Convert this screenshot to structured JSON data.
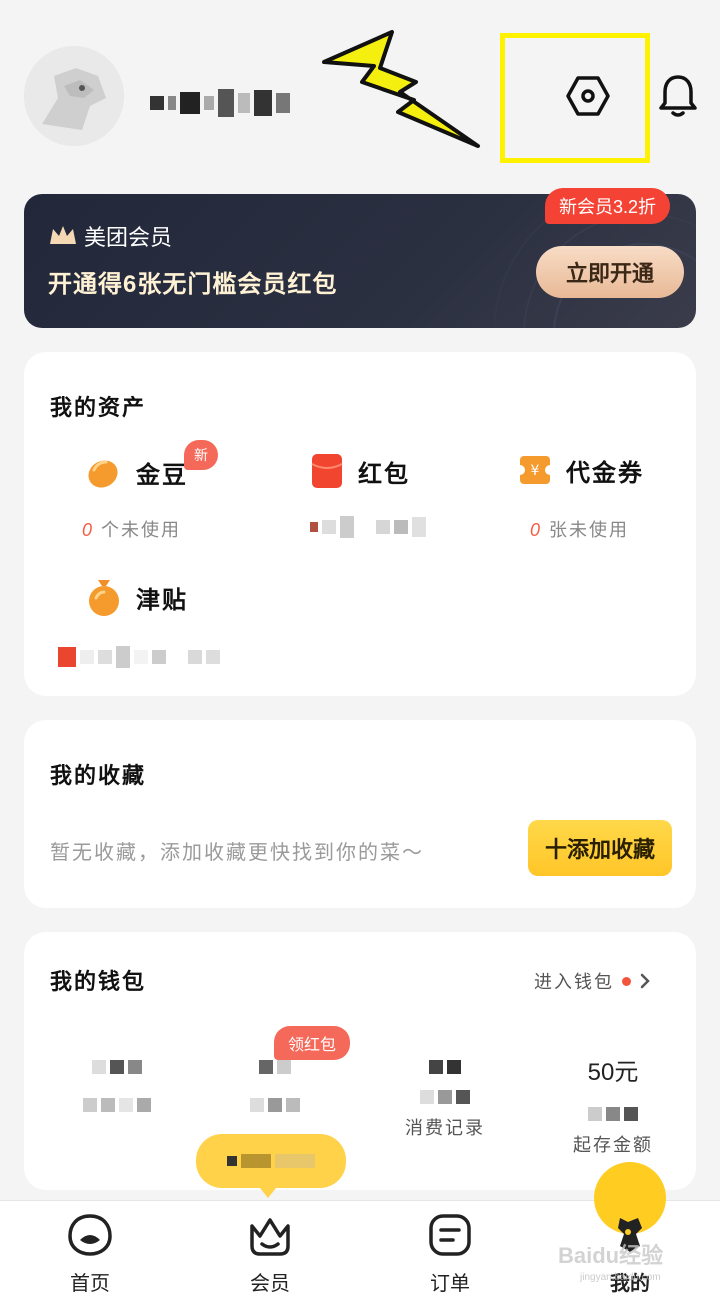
{
  "header": {
    "settings_icon": "settings-icon",
    "bell_icon": "bell-icon"
  },
  "member_banner": {
    "brand": "美团会员",
    "description": "开通得6张无门槛会员红包",
    "cta": "立即开通",
    "badge": "新会员3.2折"
  },
  "assets": {
    "title": "我的资产",
    "items": [
      {
        "label": "金豆",
        "badge": "新",
        "sub_num": "0",
        "sub_text": "个未使用"
      },
      {
        "label": "红包"
      },
      {
        "label": "代金券",
        "sub_num": "0",
        "sub_text": "张未使用"
      },
      {
        "label": "津贴"
      }
    ]
  },
  "favorites": {
    "title": "我的收藏",
    "empty_text": "暂无收藏，添加收藏更快找到你的菜～",
    "add_button": "十添加收藏"
  },
  "wallet": {
    "title": "我的钱包",
    "link": "进入钱包",
    "badge": "领红包",
    "items": [
      {
        "label": "",
        "value": ""
      },
      {
        "label": "",
        "value": ""
      },
      {
        "label": "消费记录",
        "value": ""
      },
      {
        "label": "起存金额",
        "value": "50元"
      }
    ]
  },
  "bottom_nav": {
    "items": [
      {
        "label": "首页"
      },
      {
        "label": "会员"
      },
      {
        "label": "订单"
      },
      {
        "label": "我的"
      }
    ]
  },
  "watermark": {
    "main": "Baidu经验",
    "sub": "jingyan.baidu.com"
  },
  "colors": {
    "accent_yellow": "#ffcc22",
    "highlight_box": "#fff200",
    "red": "#f4533e"
  }
}
